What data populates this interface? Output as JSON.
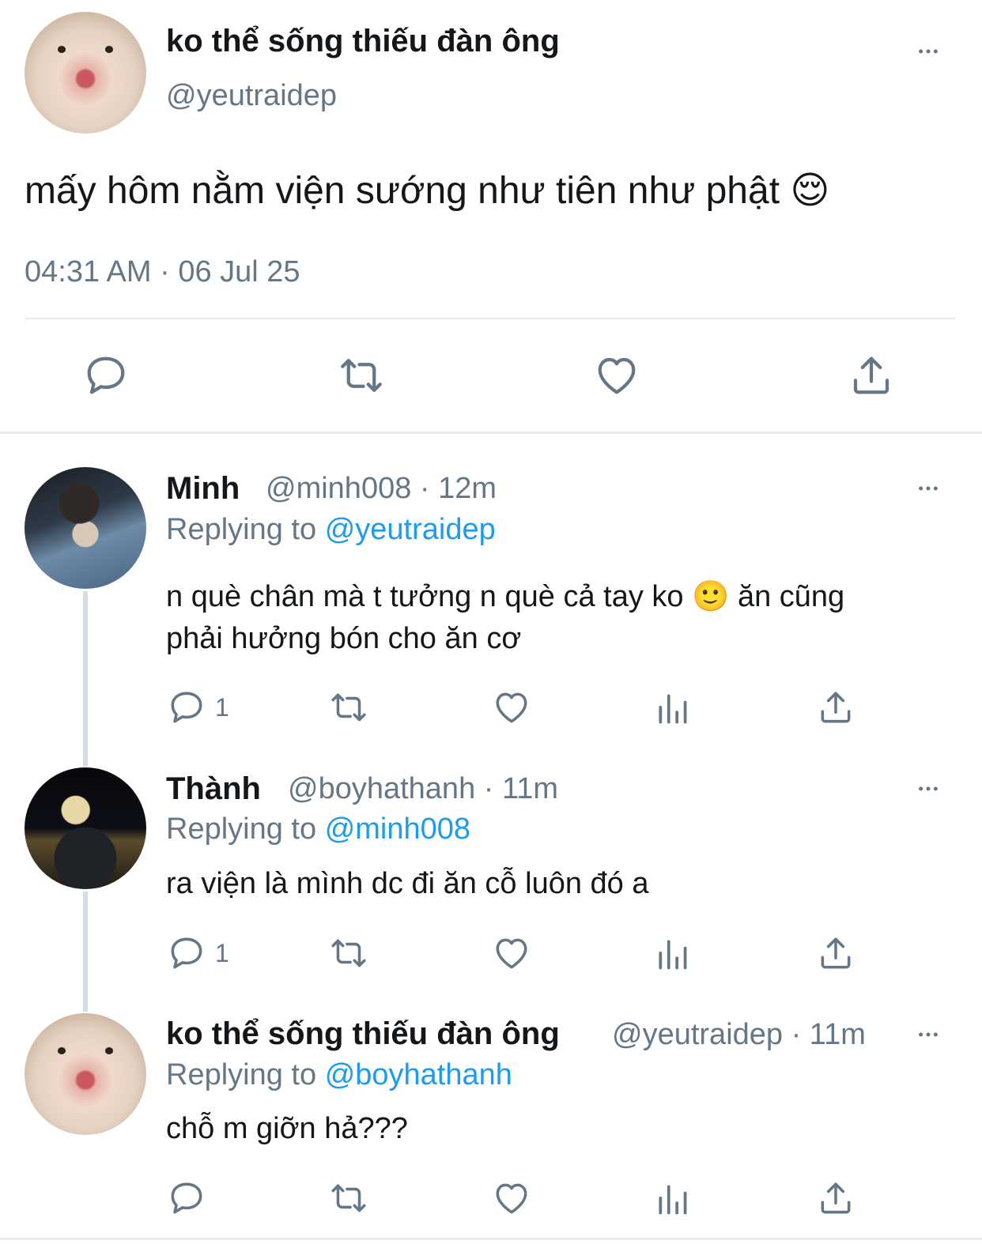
{
  "main_tweet": {
    "display_name": "ko thể sống thiếu đàn ông",
    "handle": "@yeutraidep",
    "text": "mấy hôm nằm viện sướng như tiên như phật 😌",
    "timestamp": "04:31 AM · 06 Jul 25"
  },
  "replies": [
    {
      "display_name": "Minh",
      "handle_time": "@minh008 · 12m",
      "replying_prefix": "Replying to",
      "replying_to": "@yeutraidep",
      "text_line1": "n què chân mà t tưởng n què cả tay ko 🙂  ăn cũng",
      "text_line2": "phải hưởng bón cho ăn cơ",
      "reply_count": "1"
    },
    {
      "display_name": "Thành",
      "handle_time": "@boyhathanh · 11m",
      "replying_prefix": "Replying to",
      "replying_to": "@minh008",
      "text_line1": "ra viện là mình dc đi ăn cỗ luôn đó a",
      "reply_count": "1"
    },
    {
      "display_name": "ko thể sống thiếu đàn ông",
      "handle_time": "@yeutraidep · 11m",
      "replying_prefix": "Replying to",
      "replying_to": "@boyhathanh",
      "text_line1": "chỗ m giỡn hả???",
      "reply_count": ""
    }
  ],
  "icons": [
    "more-icon",
    "reply-icon",
    "retweet-icon",
    "like-icon",
    "share-icon",
    "analytics-icon"
  ],
  "colors": {
    "link": "#1d9bf0",
    "secondary": "#657786",
    "text": "#14171a",
    "divider": "#e6ecf0"
  }
}
